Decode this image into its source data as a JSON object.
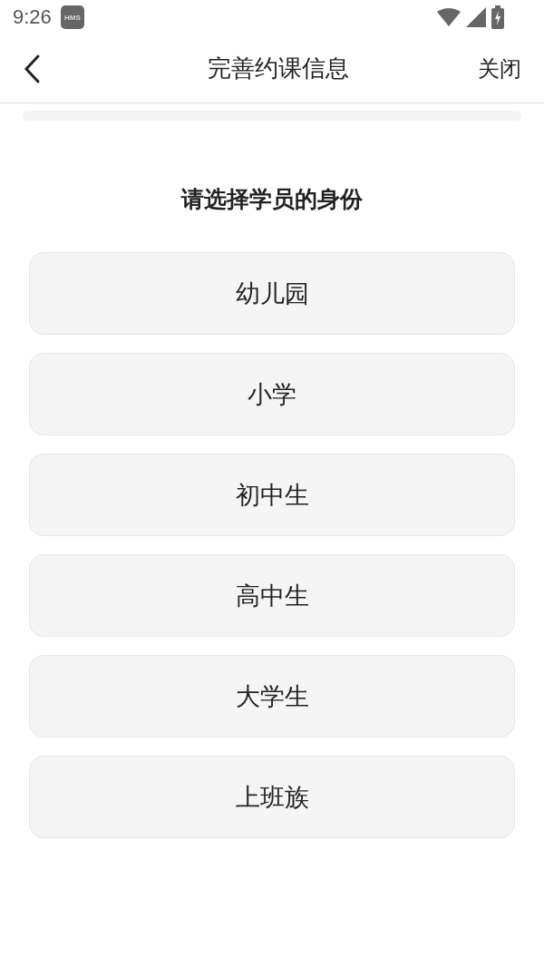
{
  "status_bar": {
    "time": "9:26",
    "notification_badge": "HMS"
  },
  "nav": {
    "title": "完善约课信息",
    "close": "关闭"
  },
  "question": "请选择学员的身份",
  "options": [
    {
      "label": "幼儿园",
      "selected": false
    },
    {
      "label": "小学",
      "selected": false
    },
    {
      "label": "初中生",
      "selected": false
    },
    {
      "label": "高中生",
      "selected": false
    },
    {
      "label": "大学生",
      "selected": false
    },
    {
      "label": "上班族",
      "selected": false
    }
  ]
}
